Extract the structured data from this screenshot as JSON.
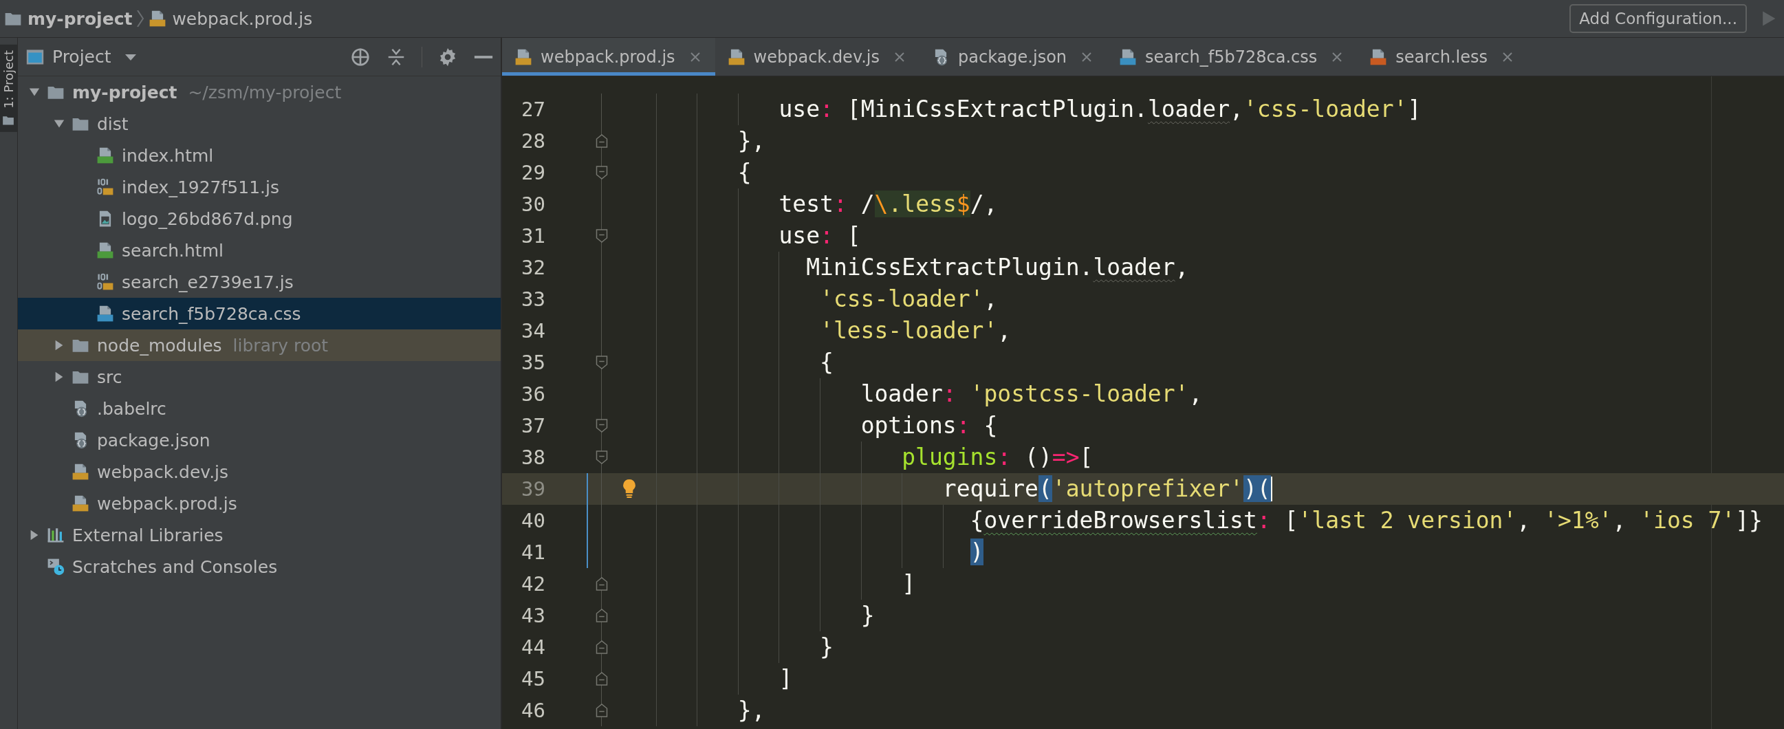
{
  "breadcrumbs": [
    {
      "label": "my-project",
      "kind": "folder"
    },
    {
      "label": "webpack.prod.js",
      "kind": "js"
    }
  ],
  "run_config": {
    "label": "Add Configuration...",
    "run_disabled": true
  },
  "tool_strip": [
    {
      "label": "1: Project",
      "selected": true
    }
  ],
  "project_panel": {
    "view": "Project",
    "tree": [
      {
        "name": "my-project",
        "kind": "project",
        "hint": "~/zsm/my-project",
        "selected": false,
        "expanded": true,
        "children": [
          {
            "name": "dist",
            "kind": "folder",
            "selected": false,
            "expanded": true,
            "children": [
              {
                "name": "index.html",
                "kind": "html",
                "selected": false
              },
              {
                "name": "index_1927f511.js",
                "kind": "jsmin",
                "selected": false
              },
              {
                "name": "logo_26bd867d.png",
                "kind": "image",
                "selected": false
              },
              {
                "name": "search.html",
                "kind": "html",
                "selected": false
              },
              {
                "name": "search_e2739e17.js",
                "kind": "jsmin",
                "selected": false
              },
              {
                "name": "search_f5b728ca.css",
                "kind": "css",
                "selected": true
              }
            ]
          },
          {
            "name": "node_modules",
            "kind": "library-folder",
            "hint": "library root",
            "selected": false,
            "expanded": false
          },
          {
            "name": "src",
            "kind": "folder",
            "selected": false,
            "expanded": false
          },
          {
            "name": ".babelrc",
            "kind": "config",
            "selected": false
          },
          {
            "name": "package.json",
            "kind": "config",
            "selected": false
          },
          {
            "name": "webpack.dev.js",
            "kind": "js",
            "selected": false
          },
          {
            "name": "webpack.prod.js",
            "kind": "js",
            "selected": false
          }
        ]
      },
      {
        "name": "External Libraries",
        "kind": "libraries",
        "selected": false,
        "expanded": false
      },
      {
        "name": "Scratches and Consoles",
        "kind": "scratches",
        "selected": false
      }
    ]
  },
  "tabs": [
    {
      "label": "webpack.prod.js",
      "kind": "js",
      "selected": true
    },
    {
      "label": "webpack.dev.js",
      "kind": "js",
      "selected": false
    },
    {
      "label": "package.json",
      "kind": "config",
      "selected": false
    },
    {
      "label": "search_f5b728ca.css",
      "kind": "css",
      "selected": false
    },
    {
      "label": "search.less",
      "kind": "less",
      "selected": false
    }
  ],
  "code_lines": [
    {
      "number": "27",
      "kind": "plain",
      "current": false,
      "changed": false,
      "bulb": false,
      "tokens": [
        {
          "text": "            use",
          "kind": "plain"
        },
        {
          "text": ":",
          "kind": "colon"
        },
        {
          "text": " [MiniCssExtractPlugin.",
          "kind": "plain"
        },
        {
          "text": "loader",
          "kind": "weak-warning"
        },
        {
          "text": ",",
          "kind": "plain"
        },
        {
          "text": "'css-loader'",
          "kind": "string"
        },
        {
          "text": "]",
          "kind": "plain"
        }
      ]
    },
    {
      "number": "28",
      "kind": "fold-end",
      "current": false,
      "changed": false,
      "bulb": false,
      "tokens": [
        {
          "text": "         },",
          "kind": "plain"
        }
      ]
    },
    {
      "number": "29",
      "kind": "fold-start",
      "current": false,
      "changed": false,
      "bulb": false,
      "tokens": [
        {
          "text": "         {",
          "kind": "plain"
        }
      ]
    },
    {
      "number": "30",
      "kind": "plain",
      "current": false,
      "changed": false,
      "bulb": false,
      "tokens": [
        {
          "text": "            test",
          "kind": "plain"
        },
        {
          "text": ":",
          "kind": "colon"
        },
        {
          "text": " /",
          "kind": "plain"
        },
        {
          "text": "\\",
          "kind": "regex-op"
        },
        {
          "text": ".less",
          "kind": "regex"
        },
        {
          "text": "$",
          "kind": "regex-op"
        },
        {
          "text": "/,",
          "kind": "plain"
        }
      ]
    },
    {
      "number": "31",
      "kind": "fold-start",
      "current": false,
      "changed": false,
      "bulb": false,
      "tokens": [
        {
          "text": "            use",
          "kind": "plain"
        },
        {
          "text": ":",
          "kind": "colon"
        },
        {
          "text": " [",
          "kind": "plain"
        }
      ]
    },
    {
      "number": "32",
      "kind": "plain",
      "current": false,
      "changed": false,
      "bulb": false,
      "tokens": [
        {
          "text": "              MiniCssExtractPlugin.",
          "kind": "plain"
        },
        {
          "text": "loader",
          "kind": "weak-warning"
        },
        {
          "text": ",",
          "kind": "plain"
        }
      ]
    },
    {
      "number": "33",
      "kind": "plain",
      "current": false,
      "changed": false,
      "bulb": false,
      "tokens": [
        {
          "text": "               'css-loader'",
          "kind": "string"
        },
        {
          "text": ",",
          "kind": "plain"
        }
      ]
    },
    {
      "number": "34",
      "kind": "plain",
      "current": false,
      "changed": false,
      "bulb": false,
      "tokens": [
        {
          "text": "               'less-loader'",
          "kind": "string"
        },
        {
          "text": ",",
          "kind": "plain"
        }
      ]
    },
    {
      "number": "35",
      "kind": "fold-start",
      "current": false,
      "changed": false,
      "bulb": false,
      "tokens": [
        {
          "text": "               {",
          "kind": "plain"
        }
      ]
    },
    {
      "number": "36",
      "kind": "plain",
      "current": false,
      "changed": false,
      "bulb": false,
      "tokens": [
        {
          "text": "                  loader",
          "kind": "plain"
        },
        {
          "text": ":",
          "kind": "colon"
        },
        {
          "text": " 'postcss-loader'",
          "kind": "string"
        },
        {
          "text": ",",
          "kind": "plain"
        }
      ]
    },
    {
      "number": "37",
      "kind": "fold-start",
      "current": false,
      "changed": false,
      "bulb": false,
      "tokens": [
        {
          "text": "                  options",
          "kind": "plain"
        },
        {
          "text": ":",
          "kind": "colon"
        },
        {
          "text": " {",
          "kind": "plain"
        }
      ]
    },
    {
      "number": "38",
      "kind": "fold-start",
      "current": false,
      "changed": false,
      "bulb": false,
      "tokens": [
        {
          "text": "                     plugins",
          "kind": "key"
        },
        {
          "text": ":",
          "kind": "colon"
        },
        {
          "text": " ()",
          "kind": "plain"
        },
        {
          "text": "=>",
          "kind": "arrow"
        },
        {
          "text": "[",
          "kind": "plain"
        }
      ]
    },
    {
      "number": "39",
      "kind": "plain",
      "current": true,
      "changed": true,
      "bulb": true,
      "tokens": [
        {
          "text": "                        require",
          "kind": "plain"
        },
        {
          "text": "(",
          "kind": "match"
        },
        {
          "text": "'autoprefixer'",
          "kind": "string"
        },
        {
          "text": ")(",
          "kind": "match"
        }
      ]
    },
    {
      "number": "40",
      "kind": "plain",
      "current": false,
      "changed": true,
      "bulb": false,
      "tokens": [
        {
          "text": "                          {",
          "kind": "plain"
        },
        {
          "text": "overrideBrowserslist",
          "kind": "typo"
        },
        {
          "text": ":",
          "kind": "colon"
        },
        {
          "text": " [",
          "kind": "plain"
        },
        {
          "text": "'last 2 version'",
          "kind": "string"
        },
        {
          "text": ", ",
          "kind": "plain"
        },
        {
          "text": "'>1%'",
          "kind": "string"
        },
        {
          "text": ", ",
          "kind": "plain"
        },
        {
          "text": "'ios 7'",
          "kind": "string"
        },
        {
          "text": "]}",
          "kind": "plain"
        }
      ]
    },
    {
      "number": "41",
      "kind": "plain",
      "current": false,
      "changed": true,
      "bulb": false,
      "tokens": [
        {
          "text": "                          )",
          "kind": "match"
        }
      ]
    },
    {
      "number": "42",
      "kind": "fold-end",
      "current": false,
      "changed": false,
      "bulb": false,
      "tokens": [
        {
          "text": "                     ]",
          "kind": "plain"
        }
      ]
    },
    {
      "number": "43",
      "kind": "fold-end",
      "current": false,
      "changed": false,
      "bulb": false,
      "tokens": [
        {
          "text": "                  }",
          "kind": "plain"
        }
      ]
    },
    {
      "number": "44",
      "kind": "fold-end",
      "current": false,
      "changed": false,
      "bulb": false,
      "tokens": [
        {
          "text": "               }",
          "kind": "plain"
        }
      ]
    },
    {
      "number": "45",
      "kind": "fold-end",
      "current": false,
      "changed": false,
      "bulb": false,
      "tokens": [
        {
          "text": "            ]",
          "kind": "plain"
        }
      ]
    },
    {
      "number": "46",
      "kind": "fold-end",
      "current": false,
      "changed": false,
      "bulb": false,
      "tokens": [
        {
          "text": "         },",
          "kind": "plain"
        }
      ]
    }
  ]
}
